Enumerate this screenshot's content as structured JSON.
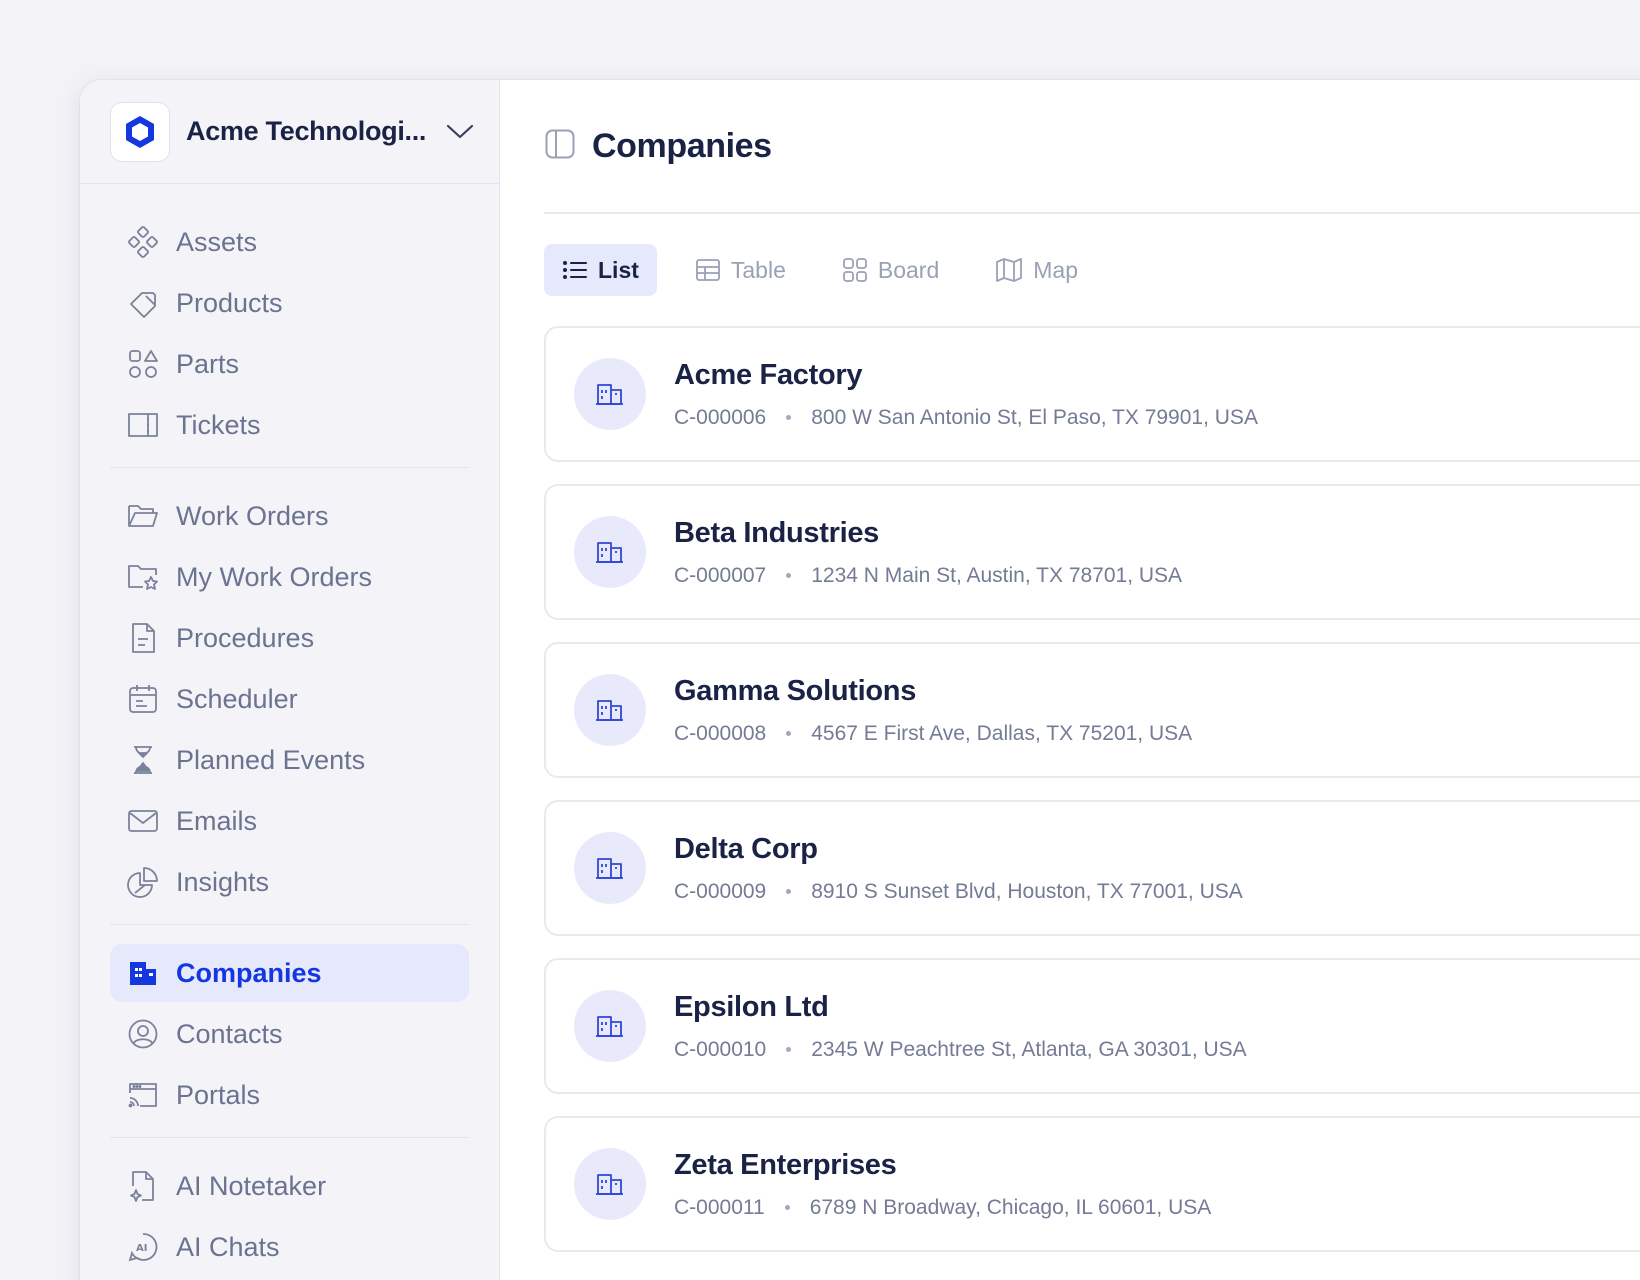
{
  "org": {
    "name": "Acme Technologi..."
  },
  "sidebar": {
    "groups": [
      [
        {
          "label": "Assets",
          "icon": "assets-icon"
        },
        {
          "label": "Products",
          "icon": "tag-icon"
        },
        {
          "label": "Parts",
          "icon": "shapes-icon"
        },
        {
          "label": "Tickets",
          "icon": "ticket-icon"
        }
      ],
      [
        {
          "label": "Work Orders",
          "icon": "folder-open-icon"
        },
        {
          "label": "My Work Orders",
          "icon": "folder-star-icon"
        },
        {
          "label": "Procedures",
          "icon": "document-icon"
        },
        {
          "label": "Scheduler",
          "icon": "calendar-icon"
        },
        {
          "label": "Planned Events",
          "icon": "hourglass-icon"
        },
        {
          "label": "Emails",
          "icon": "mail-icon"
        },
        {
          "label": "Insights",
          "icon": "pie-chart-icon"
        }
      ],
      [
        {
          "label": "Companies",
          "icon": "building-icon",
          "active": true
        },
        {
          "label": "Contacts",
          "icon": "user-circle-icon"
        },
        {
          "label": "Portals",
          "icon": "portal-icon"
        }
      ],
      [
        {
          "label": "AI Notetaker",
          "icon": "ai-note-icon"
        },
        {
          "label": "AI Chats",
          "icon": "ai-chat-icon"
        }
      ]
    ]
  },
  "page": {
    "title": "Companies"
  },
  "views": [
    {
      "label": "List",
      "icon": "list-icon",
      "active": true
    },
    {
      "label": "Table",
      "icon": "table-icon"
    },
    {
      "label": "Board",
      "icon": "board-icon"
    },
    {
      "label": "Map",
      "icon": "map-icon"
    }
  ],
  "companies": [
    {
      "name": "Acme Factory",
      "code": "C-000006",
      "address": "800 W San Antonio St, El Paso, TX 79901, USA"
    },
    {
      "name": "Beta Industries",
      "code": "C-000007",
      "address": "1234 N Main St, Austin, TX 78701, USA"
    },
    {
      "name": "Gamma Solutions",
      "code": "C-000008",
      "address": "4567 E First Ave, Dallas, TX 75201, USA"
    },
    {
      "name": "Delta Corp",
      "code": "C-000009",
      "address": "8910 S Sunset Blvd, Houston, TX 77001, USA"
    },
    {
      "name": "Epsilon Ltd",
      "code": "C-000010",
      "address": "2345 W Peachtree St, Atlanta, GA 30301, USA"
    },
    {
      "name": "Zeta Enterprises",
      "code": "C-000011",
      "address": "6789 N Broadway, Chicago, IL 60601, USA"
    }
  ],
  "colors": {
    "accent": "#1537e0",
    "active_bg": "#e6e9fb",
    "muted_text": "#6a7390"
  }
}
